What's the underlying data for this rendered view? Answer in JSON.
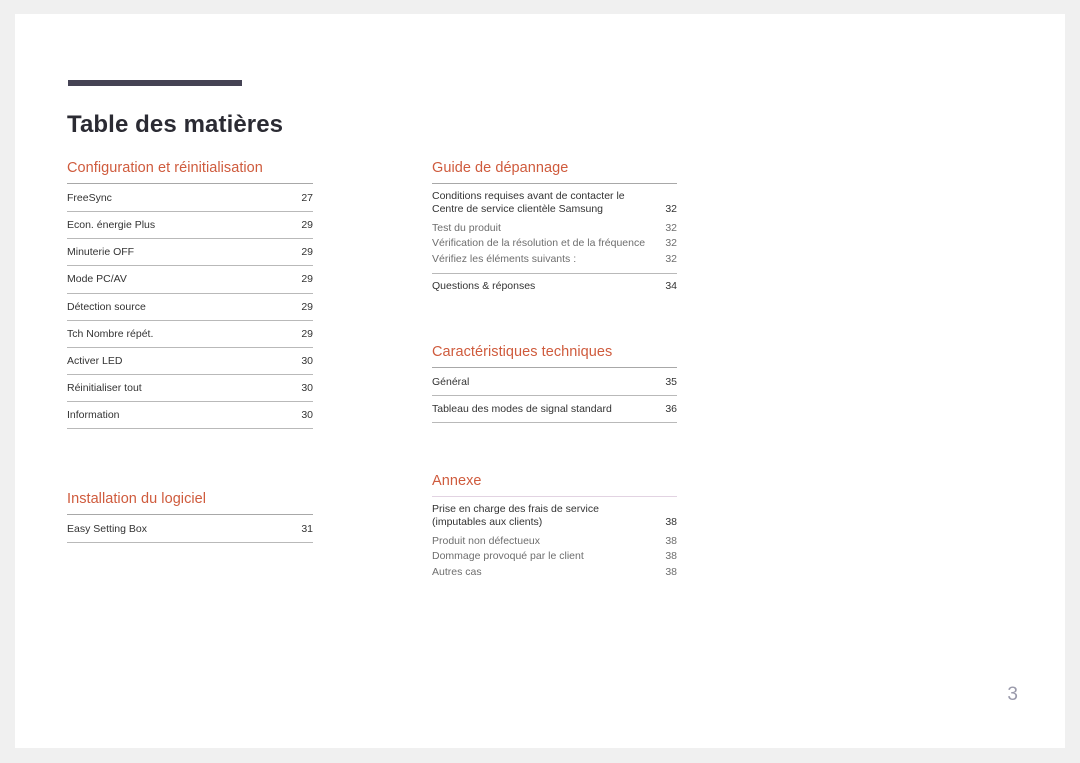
{
  "document": {
    "title": "Table des matières",
    "page_number": "3",
    "accent_color": "#cf5b3d",
    "title_bar_color": "#454354",
    "page_number_color": "#9a9aab"
  },
  "left_column": {
    "sections": [
      {
        "heading": "Configuration et réinitialisation",
        "entries": [
          {
            "label": "FreeSync",
            "page": "27"
          },
          {
            "label": "Econ. énergie Plus",
            "page": "29"
          },
          {
            "label": "Minuterie OFF",
            "page": "29"
          },
          {
            "label": "Mode PC/AV",
            "page": "29"
          },
          {
            "label": "Détection source",
            "page": "29"
          },
          {
            "label": "Tch Nombre répét.",
            "page": "29"
          },
          {
            "label": "Activer LED",
            "page": "30"
          },
          {
            "label": "Réinitialiser tout",
            "page": "30"
          },
          {
            "label": "Information",
            "page": "30"
          }
        ]
      },
      {
        "heading": "Installation du logiciel",
        "entries": [
          {
            "label": "Easy Setting Box",
            "page": "31"
          }
        ]
      }
    ]
  },
  "right_column": {
    "sections": [
      {
        "heading": "Guide de dépannage",
        "parent": {
          "line1": "Conditions requises avant de contacter le",
          "line2": "Centre de service clientèle Samsung",
          "page": "32"
        },
        "sub_entries": [
          {
            "label": "Test du produit",
            "page": "32"
          },
          {
            "label": "Vérification de la résolution et de la fréquence",
            "page": "32"
          },
          {
            "label": "Vérifiez les éléments suivants :",
            "page": "32"
          }
        ],
        "footer_entry": {
          "label": "Questions & réponses",
          "page": "34"
        }
      },
      {
        "heading": "Caractéristiques techniques",
        "entries": [
          {
            "label": "Général",
            "page": "35"
          },
          {
            "label": "Tableau des modes de signal standard",
            "page": "36"
          }
        ]
      },
      {
        "heading": "Annexe",
        "parent": {
          "line1": "Prise en charge des frais de service",
          "line2": "(imputables aux clients)",
          "page": "38"
        },
        "sub_entries": [
          {
            "label": "Produit non défectueux",
            "page": "38"
          },
          {
            "label": "Dommage provoqué par le client",
            "page": "38"
          },
          {
            "label": "Autres cas",
            "page": "38"
          }
        ]
      }
    ]
  }
}
